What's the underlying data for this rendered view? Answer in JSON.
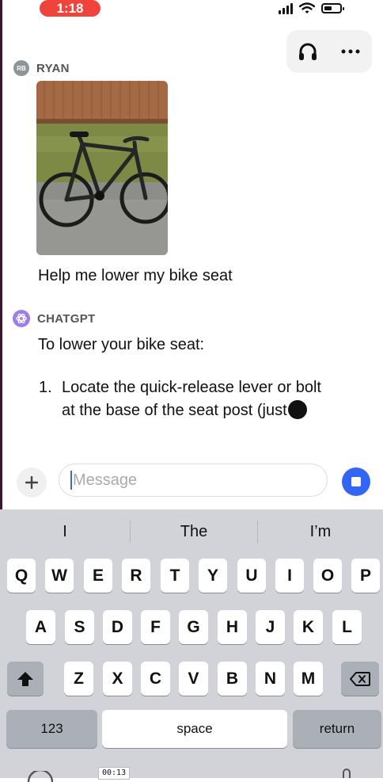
{
  "status_bar": {
    "time": "1:18",
    "icons": [
      "signal-icon",
      "wifi-icon",
      "battery-icon"
    ]
  },
  "header": {
    "icons": [
      "headphones-icon",
      "more-icon"
    ]
  },
  "messages": [
    {
      "sender": "RYAN",
      "avatar_initials": "RB",
      "text": "Help me lower my bike seat",
      "image": "bike-photo"
    },
    {
      "sender": "CHATGPT",
      "intro": "To lower your bike seat:",
      "item_number": "1.",
      "item_line1": "Locate the quick-release lever or bolt",
      "item_line2": "at the base of the seat post (just"
    }
  ],
  "composer": {
    "placeholder": "Message",
    "accent": "#3366f5"
  },
  "keyboard": {
    "suggestions": [
      "I",
      "The",
      "I’m"
    ],
    "row1": [
      "Q",
      "W",
      "E",
      "R",
      "T",
      "Y",
      "U",
      "I",
      "O",
      "P"
    ],
    "row2": [
      "A",
      "S",
      "D",
      "F",
      "G",
      "H",
      "J",
      "K",
      "L"
    ],
    "row3": [
      "Z",
      "X",
      "C",
      "V",
      "B",
      "N",
      "M"
    ],
    "numbers_label": "123",
    "space_label": "space",
    "return_label": "return"
  },
  "recording_time": "00:13",
  "colors": {
    "time_pill": "#f0433c",
    "gpt_avatar": "#a07ee8",
    "keyboard_bg": "#d1d3d9"
  }
}
